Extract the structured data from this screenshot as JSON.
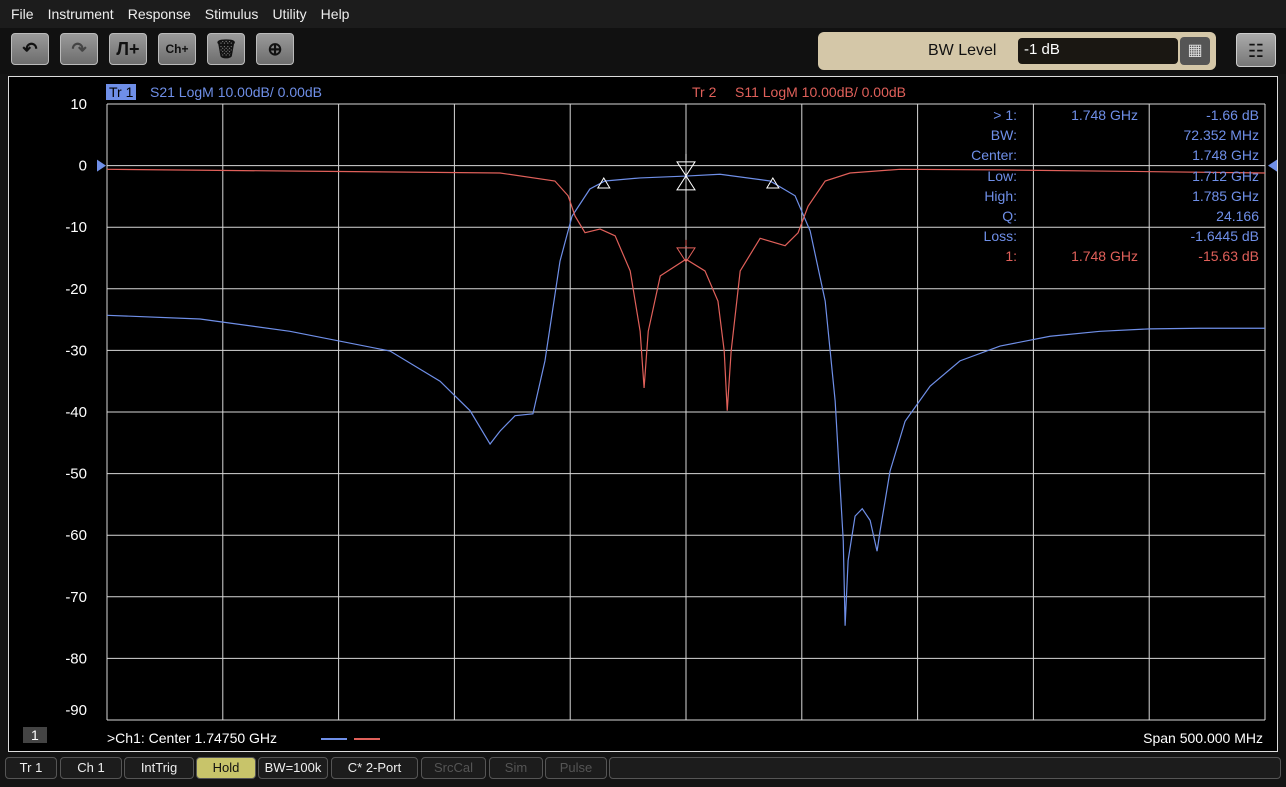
{
  "menu": [
    "File",
    "Instrument",
    "Response",
    "Stimulus",
    "Utility",
    "Help"
  ],
  "toolbar": {
    "buttons": [
      "undo-icon",
      "redo-icon",
      "add-trace-icon",
      "add-channel-icon",
      "delete-icon",
      "zoom-icon"
    ],
    "bw_label": "BW Level",
    "bw_value": "-1 dB"
  },
  "traces": {
    "tr1_tag": "Tr 1",
    "tr1_desc": "S21 LogM 10.00dB/  0.00dB",
    "tr2_tag": "Tr 2",
    "tr2_desc": "S11 LogM 10.00dB/  0.00dB",
    "tr1_color": "#6f8fe8",
    "tr2_color": "#e0605a"
  },
  "markers": {
    "rows": [
      {
        "label": "> 1:",
        "freq": "1.748  GHz",
        "value": "-1.66 dB",
        "trace": 1
      },
      {
        "label": "BW:",
        "freq": "",
        "value": "72.352 MHz",
        "trace": 1
      },
      {
        "label": "Center:",
        "freq": "",
        "value": "1.748 GHz",
        "trace": 1
      },
      {
        "label": "Low:",
        "freq": "",
        "value": "1.712 GHz",
        "trace": 1
      },
      {
        "label": "High:",
        "freq": "",
        "value": "1.785 GHz",
        "trace": 1
      },
      {
        "label": "Q:",
        "freq": "",
        "value": "24.166",
        "trace": 1
      },
      {
        "label": "Loss:",
        "freq": "",
        "value": "-1.6445 dB",
        "trace": 1
      },
      {
        "label": "1:",
        "freq": "1.748  GHz",
        "value": "-15.63 dB",
        "trace": 2
      }
    ]
  },
  "footer": {
    "channel_num": "1",
    "center": ">Ch1:  Center   1.74750 GHz",
    "span": "Span  500.000 MHz"
  },
  "status": [
    "Tr 1",
    "Ch 1",
    "IntTrig",
    "Hold",
    "BW=100k",
    "C* 2-Port",
    "SrcCal",
    "Sim",
    "Pulse"
  ],
  "chart_data": {
    "type": "line",
    "xlim": [
      1.4975,
      1.9975
    ],
    "xunit": "GHz",
    "ylim": [
      -90,
      10
    ],
    "yticks": [
      "10",
      "0",
      "-10",
      "-20",
      "-30",
      "-40",
      "-50",
      "-60",
      "-70",
      "-80",
      "-90"
    ],
    "grid": true,
    "series": [
      {
        "name": "S21",
        "x": [
          1.4975,
          1.5377,
          1.5765,
          1.6197,
          1.6413,
          1.6543,
          1.6629,
          1.6672,
          1.6737,
          1.6814,
          1.6866,
          1.6931,
          1.6983,
          1.706,
          1.7125,
          1.7277,
          1.7475,
          1.7622,
          1.7838,
          1.7946,
          1.8011,
          1.8076,
          1.8119,
          1.8154,
          1.8162,
          1.8175,
          1.8205,
          1.8236,
          1.827,
          1.83,
          1.8313,
          1.8356,
          1.8421,
          1.8529,
          1.8658,
          1.8831,
          1.9047,
          1.9263,
          1.9479,
          1.9695,
          1.9975
        ],
        "y": [
          -24.3,
          -24.9,
          -26.9,
          -30.1,
          -35,
          -39.8,
          -45.2,
          -43.1,
          -40.6,
          -40.3,
          -31.7,
          -15.5,
          -8.2,
          -3.8,
          -2.5,
          -2.0,
          -1.7,
          -1.4,
          -2.5,
          -4.9,
          -10.6,
          -22,
          -38.2,
          -60.9,
          -74.7,
          -64.1,
          -56.9,
          -55.7,
          -57.6,
          -62.6,
          -59.3,
          -49.6,
          -41.5,
          -35.8,
          -31.7,
          -29.3,
          -27.7,
          -26.9,
          -26.5,
          -26.4,
          -26.4
        ]
      },
      {
        "name": "S11",
        "x": [
          1.4975,
          1.5808,
          1.6672,
          1.6909,
          1.6966,
          1.6996,
          1.7039,
          1.7104,
          1.7169,
          1.7234,
          1.7277,
          1.7294,
          1.7312,
          1.7364,
          1.7475,
          1.7557,
          1.7613,
          1.764,
          1.7653,
          1.767,
          1.7709,
          1.7795,
          1.7903,
          1.7959,
          1.8002,
          1.8076,
          1.8183,
          1.8399,
          1.8831,
          1.9975
        ],
        "y": [
          -0.6,
          -0.9,
          -1.2,
          -2.5,
          -4.9,
          -8.2,
          -10.9,
          -10.3,
          -11.4,
          -17.1,
          -26.9,
          -36.1,
          -26.9,
          -17.9,
          -15.2,
          -17.1,
          -22,
          -30.1,
          -39.8,
          -30.1,
          -17.1,
          -11.8,
          -13,
          -10.9,
          -6.6,
          -2.5,
          -1.2,
          -0.6,
          -0.7,
          -1.2
        ]
      }
    ],
    "marker_points": [
      {
        "series": "S21",
        "x": 1.7475,
        "y": -1.66
      },
      {
        "series": "S11",
        "x": 1.7475,
        "y": -15.63
      }
    ],
    "bw_points": [
      {
        "x": 1.712,
        "y": -2.66
      },
      {
        "x": 1.785,
        "y": -2.66
      }
    ]
  }
}
